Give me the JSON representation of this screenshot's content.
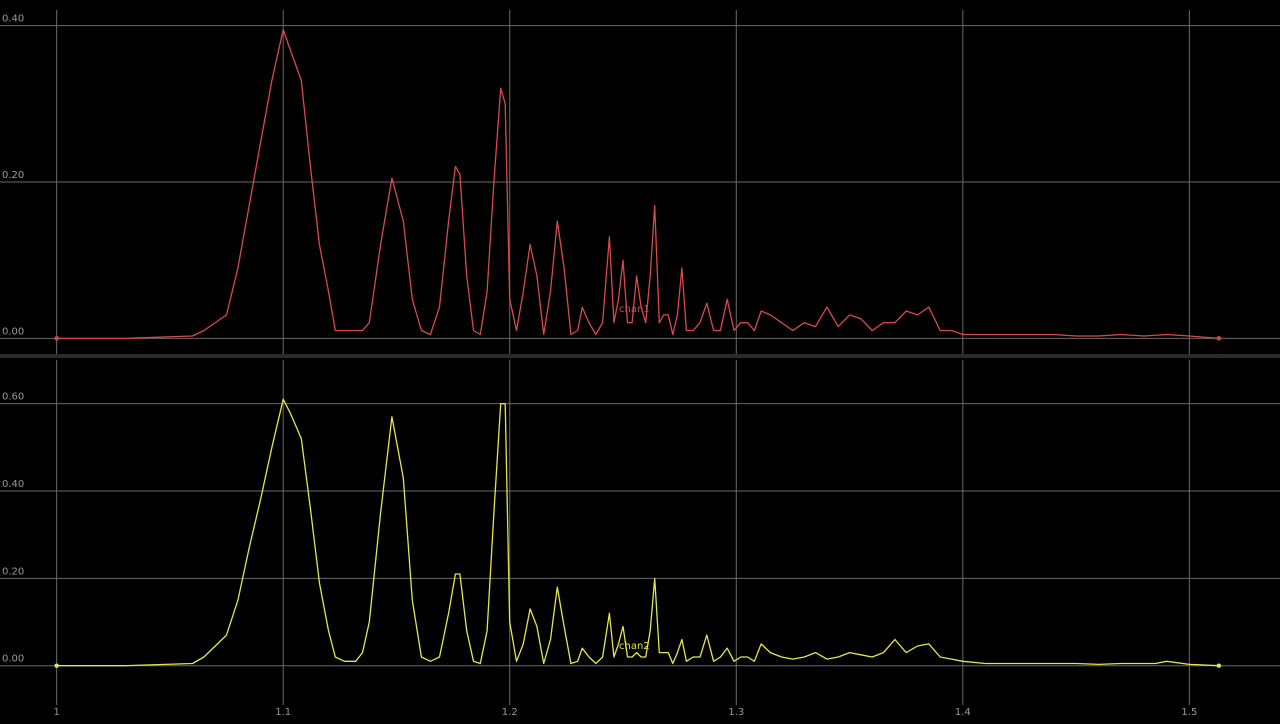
{
  "chart_data": [
    {
      "type": "line",
      "series": [
        {
          "name": "chan1",
          "color": "#d84a4a",
          "x": [
            1.0,
            1.03,
            1.06,
            1.065,
            1.075,
            1.08,
            1.085,
            1.09,
            1.095,
            1.1,
            1.103,
            1.108,
            1.112,
            1.116,
            1.12,
            1.123,
            1.135,
            1.138,
            1.143,
            1.148,
            1.153,
            1.157,
            1.161,
            1.165,
            1.169,
            1.173,
            1.176,
            1.178,
            1.181,
            1.184,
            1.187,
            1.19,
            1.193,
            1.196,
            1.198,
            1.2,
            1.203,
            1.206,
            1.209,
            1.212,
            1.215,
            1.218,
            1.221,
            1.224,
            1.227,
            1.23,
            1.232,
            1.235,
            1.238,
            1.241,
            1.244,
            1.246,
            1.248,
            1.25,
            1.252,
            1.254,
            1.256,
            1.258,
            1.26,
            1.262,
            1.264,
            1.266,
            1.268,
            1.27,
            1.272,
            1.274,
            1.276,
            1.278,
            1.281,
            1.284,
            1.287,
            1.29,
            1.293,
            1.296,
            1.299,
            1.302,
            1.305,
            1.308,
            1.311,
            1.315,
            1.32,
            1.325,
            1.33,
            1.335,
            1.34,
            1.345,
            1.35,
            1.355,
            1.36,
            1.365,
            1.37,
            1.375,
            1.38,
            1.385,
            1.39,
            1.395,
            1.4,
            1.41,
            1.42,
            1.43,
            1.44,
            1.45,
            1.46,
            1.47,
            1.48,
            1.49,
            1.5,
            1.513
          ],
          "y": [
            0.0,
            0.0,
            0.003,
            0.01,
            0.03,
            0.09,
            0.17,
            0.25,
            0.33,
            0.395,
            0.37,
            0.33,
            0.22,
            0.12,
            0.06,
            0.01,
            0.01,
            0.02,
            0.12,
            0.205,
            0.15,
            0.05,
            0.01,
            0.005,
            0.04,
            0.15,
            0.22,
            0.21,
            0.08,
            0.01,
            0.005,
            0.06,
            0.2,
            0.32,
            0.3,
            0.05,
            0.01,
            0.06,
            0.12,
            0.08,
            0.005,
            0.06,
            0.15,
            0.09,
            0.005,
            0.01,
            0.04,
            0.02,
            0.005,
            0.02,
            0.13,
            0.02,
            0.05,
            0.1,
            0.02,
            0.02,
            0.08,
            0.04,
            0.02,
            0.08,
            0.17,
            0.02,
            0.03,
            0.03,
            0.005,
            0.03,
            0.09,
            0.01,
            0.01,
            0.02,
            0.045,
            0.01,
            0.01,
            0.05,
            0.01,
            0.02,
            0.02,
            0.01,
            0.035,
            0.03,
            0.02,
            0.01,
            0.02,
            0.015,
            0.04,
            0.015,
            0.03,
            0.025,
            0.01,
            0.02,
            0.02,
            0.035,
            0.03,
            0.04,
            0.01,
            0.01,
            0.005,
            0.005,
            0.005,
            0.005,
            0.005,
            0.003,
            0.003,
            0.005,
            0.003,
            0.005,
            0.003,
            0.0
          ]
        }
      ],
      "ylim": [
        -0.02,
        0.42
      ],
      "yticks": [
        {
          "value": 0.0,
          "label": "0.00"
        },
        {
          "value": 0.2,
          "label": "0.20"
        },
        {
          "value": 0.4,
          "label": "0.40"
        }
      ],
      "xlim": [
        0.975,
        1.54
      ],
      "grid": true
    },
    {
      "type": "line",
      "series": [
        {
          "name": "chan2",
          "color": "#e6e64a",
          "x": [
            1.0,
            1.03,
            1.06,
            1.065,
            1.075,
            1.08,
            1.085,
            1.09,
            1.095,
            1.1,
            1.103,
            1.108,
            1.112,
            1.116,
            1.12,
            1.123,
            1.127,
            1.132,
            1.135,
            1.138,
            1.143,
            1.148,
            1.153,
            1.157,
            1.161,
            1.165,
            1.169,
            1.173,
            1.176,
            1.178,
            1.181,
            1.184,
            1.187,
            1.19,
            1.193,
            1.196,
            1.198,
            1.2,
            1.203,
            1.206,
            1.209,
            1.212,
            1.215,
            1.218,
            1.221,
            1.224,
            1.227,
            1.23,
            1.232,
            1.235,
            1.238,
            1.241,
            1.244,
            1.246,
            1.248,
            1.25,
            1.252,
            1.254,
            1.256,
            1.258,
            1.26,
            1.262,
            1.264,
            1.266,
            1.268,
            1.27,
            1.272,
            1.274,
            1.276,
            1.278,
            1.281,
            1.284,
            1.287,
            1.29,
            1.293,
            1.296,
            1.299,
            1.302,
            1.305,
            1.308,
            1.311,
            1.315,
            1.32,
            1.325,
            1.33,
            1.335,
            1.34,
            1.345,
            1.35,
            1.355,
            1.36,
            1.365,
            1.37,
            1.375,
            1.38,
            1.385,
            1.39,
            1.395,
            1.4,
            1.41,
            1.42,
            1.43,
            1.44,
            1.45,
            1.46,
            1.47,
            1.48,
            1.485,
            1.49,
            1.5,
            1.513
          ],
          "y": [
            0.0,
            0.0,
            0.005,
            0.02,
            0.07,
            0.15,
            0.27,
            0.38,
            0.5,
            0.61,
            0.58,
            0.52,
            0.36,
            0.19,
            0.08,
            0.02,
            0.01,
            0.01,
            0.03,
            0.1,
            0.35,
            0.57,
            0.43,
            0.15,
            0.02,
            0.01,
            0.02,
            0.12,
            0.21,
            0.21,
            0.08,
            0.01,
            0.005,
            0.08,
            0.35,
            0.6,
            0.6,
            0.1,
            0.01,
            0.05,
            0.13,
            0.09,
            0.005,
            0.06,
            0.18,
            0.09,
            0.005,
            0.01,
            0.04,
            0.02,
            0.005,
            0.02,
            0.12,
            0.02,
            0.05,
            0.09,
            0.02,
            0.02,
            0.03,
            0.02,
            0.02,
            0.08,
            0.2,
            0.03,
            0.03,
            0.03,
            0.005,
            0.03,
            0.06,
            0.01,
            0.02,
            0.02,
            0.07,
            0.01,
            0.02,
            0.04,
            0.01,
            0.02,
            0.02,
            0.01,
            0.05,
            0.03,
            0.02,
            0.015,
            0.02,
            0.03,
            0.015,
            0.02,
            0.03,
            0.025,
            0.02,
            0.03,
            0.06,
            0.03,
            0.045,
            0.05,
            0.02,
            0.015,
            0.01,
            0.005,
            0.005,
            0.005,
            0.005,
            0.005,
            0.003,
            0.005,
            0.005,
            0.005,
            0.01,
            0.003,
            0.0
          ]
        }
      ],
      "ylim": [
        -0.09,
        0.7
      ],
      "yticks": [
        {
          "value": 0.0,
          "label": "0.00"
        },
        {
          "value": 0.2,
          "label": "0.20"
        },
        {
          "value": 0.4,
          "label": "0.40"
        },
        {
          "value": 0.6,
          "label": "0.60"
        }
      ],
      "xlim": [
        0.975,
        1.54
      ],
      "grid": true
    }
  ],
  "x_ticks": [
    {
      "value": 1.0,
      "label": "1"
    },
    {
      "value": 1.1,
      "label": "1.1"
    },
    {
      "value": 1.2,
      "label": "1.2"
    },
    {
      "value": 1.3,
      "label": "1.3"
    },
    {
      "value": 1.4,
      "label": "1.4"
    },
    {
      "value": 1.5,
      "label": "1.5"
    }
  ],
  "colors": {
    "background": "#000000",
    "grid": "#6a6a6a",
    "tick_text": "#9a9a9a",
    "divider": "#2a2a2a"
  }
}
